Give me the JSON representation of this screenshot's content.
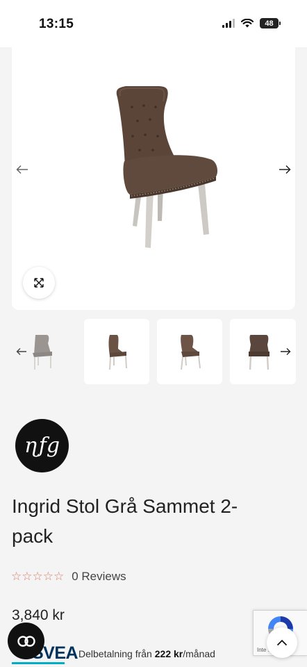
{
  "status_bar": {
    "time": "13:15",
    "battery": "48"
  },
  "product": {
    "title": "Ingrid Stol Grå Sammet 2-pack",
    "rating": {
      "stars": "☆☆☆☆☆",
      "reviews_label": "0 Reviews",
      "value": 0,
      "max": 5
    },
    "price": "3,840 kr"
  },
  "brand": {
    "logo_text": "ɳfg"
  },
  "gallery": {
    "thumbnails": [
      {
        "alt": "Grå stol",
        "color": "#9a9591"
      },
      {
        "alt": "Brun stol sida",
        "color": "#6a5244"
      },
      {
        "alt": "Brun stol vinkel",
        "color": "#6e5446"
      },
      {
        "alt": "Brun stol framifrån",
        "color": "#5a463c"
      }
    ]
  },
  "financing": {
    "provider": "SVEA",
    "text_prefix": "Delbetalning från",
    "amount": "222 kr",
    "suffix": "/månad"
  },
  "recaptcha": {
    "label": "Inte ... tor"
  },
  "icons": {
    "gallery_prev": "arrow-left-icon",
    "gallery_next": "arrow-right-icon",
    "zoom": "expand-icon",
    "chat": "chat-icon",
    "scroll_top": "chevron-up-icon"
  }
}
